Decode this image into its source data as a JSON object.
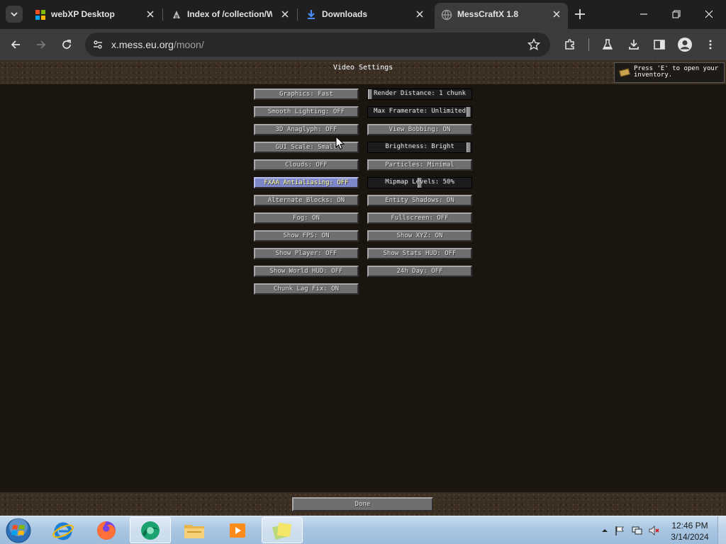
{
  "browser": {
    "tabs": [
      {
        "title": "webXP Desktop",
        "icon": "webxp-favicon"
      },
      {
        "title": "Index of /collection/W",
        "icon": "archive-favicon"
      },
      {
        "title": "Downloads",
        "icon": "download-favicon"
      },
      {
        "title": "MessCraftX 1.8",
        "icon": "globe-favicon",
        "active": true
      }
    ],
    "url_host": "x.mess.eu.org",
    "url_path": "/moon/"
  },
  "game": {
    "screen_title": "Video Settings",
    "tooltip_line1": "Press 'E' to open your",
    "tooltip_line2": "inventory.",
    "left_options": [
      "Graphics: Fast",
      "Smooth Lighting: OFF",
      "3D Anaglyph: OFF",
      "GUI Scale: Small",
      "Clouds: OFF",
      "FXAA Antialiasing: OFF",
      "Alternate Blocks: ON",
      "Fog: ON",
      "Show FPS: ON",
      "Show Player: OFF",
      "Show World HUD: OFF",
      "Chunk Lag Fix: ON"
    ],
    "right_options": [
      {
        "label": "Render Distance: 1 chunk",
        "slider": true,
        "level": 0.0
      },
      {
        "label": "Max Framerate: Unlimited",
        "slider": true,
        "level": 1.0
      },
      {
        "label": "View Bobbing: ON",
        "slider": false
      },
      {
        "label": "Brightness: Bright",
        "slider": true,
        "level": 1.0
      },
      {
        "label": "Particles: Minimal",
        "slider": false
      },
      {
        "label": "Mipmap Levels: 50%",
        "slider": true,
        "level": 0.5
      },
      {
        "label": "Entity Shadows: ON",
        "slider": false
      },
      {
        "label": "Fullscreen: OFF",
        "slider": false
      },
      {
        "label": "Show XYZ: ON",
        "slider": false
      },
      {
        "label": "Show Stats HUD: OFF",
        "slider": false
      },
      {
        "label": "24h Day: OFF",
        "slider": false
      }
    ],
    "done_label": "Done",
    "hovered_option": "FXAA Antialiasing: OFF"
  },
  "taskbar": {
    "time": "12:46 PM",
    "date": "3/14/2024",
    "apps": [
      "internet-explorer-icon",
      "firefox-icon",
      "browser-icon",
      "file-explorer-icon",
      "media-player-icon",
      "sticky-notes-icon"
    ]
  },
  "colors": {
    "chrome_bg": "#1f1f1f",
    "toolbar_bg": "#3c3c3c",
    "button_grey": "#6f6f6f",
    "button_hover": "#7e87c9",
    "game_bg": "#1b1510"
  }
}
